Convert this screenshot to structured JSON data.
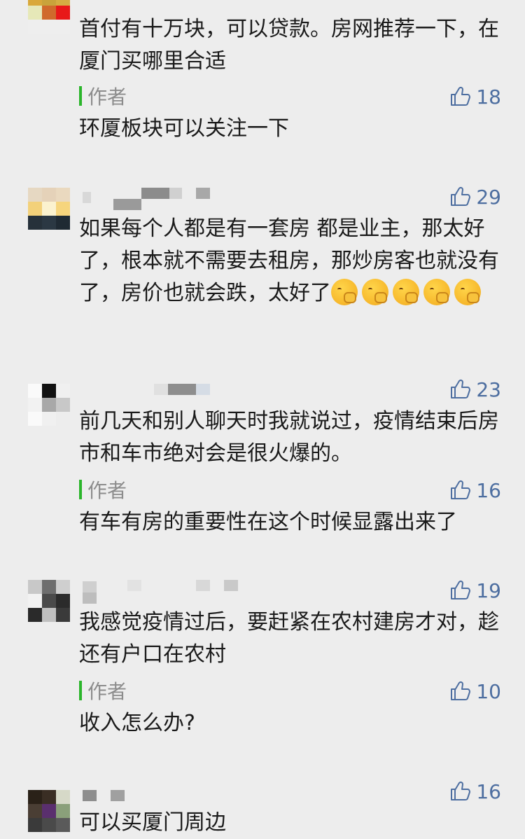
{
  "comments": [
    {
      "text": "首付有十万块，可以贷款。房网推荐一下，在厦门买哪里合适",
      "likes": "",
      "reply": {
        "label": "作者",
        "likes": "18",
        "text": "环厦板块可以关注一下"
      }
    },
    {
      "text": "如果每个人都是有一套房 都是业主，那太好了，根本就不需要去租房，那炒房客也就没有了，房价也就会跌，太好了",
      "likes": "29",
      "emoji_count": 5
    },
    {
      "text": "前几天和别人聊天时我就说过，疫情结束后房市和车市绝对会是很火爆的。",
      "likes": "23",
      "reply": {
        "label": "作者",
        "likes": "16",
        "text": "有车有房的重要性在这个时候显露出来了"
      }
    },
    {
      "text": "我感觉疫情过后，要赶紧在农村建房才对，趁还有户口在农村",
      "likes": "19",
      "reply": {
        "label": "作者",
        "likes": "10",
        "text": "收入怎么办?"
      }
    },
    {
      "text": "可以买厦门周边",
      "likes": "16"
    }
  ],
  "icons": {
    "like": "thumbs-up-icon",
    "reaction_emoji": "hugging-face-emoji"
  },
  "colors": {
    "background": "#ededed",
    "like_text": "#4d6ea0",
    "author_bar": "#2bb52b",
    "author_label": "#8c8c8c"
  }
}
